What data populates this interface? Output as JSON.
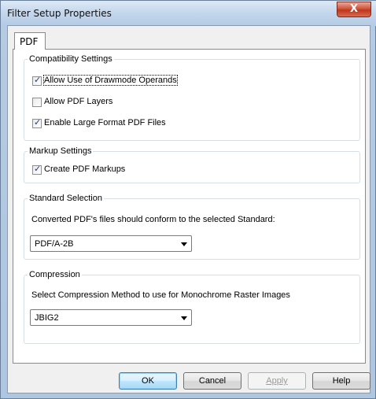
{
  "window": {
    "title": "Filter Setup Properties",
    "close_label": "X"
  },
  "tabs": [
    {
      "label": "PDF"
    }
  ],
  "compatibility": {
    "legend": "Compatibility Settings",
    "options": [
      {
        "label": "Allow Use of Drawmode Operands",
        "checked": true
      },
      {
        "label": "Allow PDF Layers",
        "checked": false
      },
      {
        "label": "Enable Large Format PDF Files",
        "checked": true
      }
    ]
  },
  "markup": {
    "legend": "Markup Settings",
    "options": [
      {
        "label": "Create PDF Markups",
        "checked": true
      }
    ]
  },
  "standard": {
    "legend": "Standard Selection",
    "description": "Converted PDF's files should conform to the selected Standard:",
    "selected": "PDF/A-2B"
  },
  "compression": {
    "legend": "Compression",
    "description": "Select Compression Method to use for Monochrome Raster Images",
    "selected": "JBIG2"
  },
  "buttons": {
    "ok": "OK",
    "cancel": "Cancel",
    "apply": "Apply",
    "help": "Help"
  }
}
